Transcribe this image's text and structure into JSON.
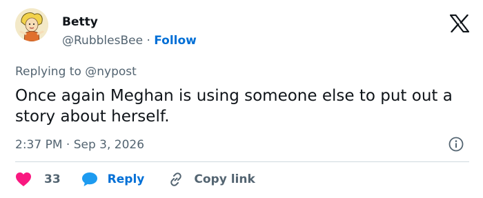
{
  "tweet": {
    "author_name": "Betty",
    "handle": "@RubblesBee",
    "separator": "·",
    "follow_label": "Follow",
    "replying_prefix": "Replying to",
    "replying_to": "@nypost",
    "text": "Once again Meghan is using someone else to put out a story about herself.",
    "time": "2:37 PM",
    "date": "Sep 3, 2026"
  },
  "actions": {
    "like_count": "33",
    "reply_label": "Reply",
    "copy_label": "Copy link"
  },
  "icons": {
    "logo": "x-logo-icon",
    "info": "info-icon",
    "like": "heart-icon",
    "reply": "speech-bubble-icon",
    "copy": "link-icon"
  },
  "colors": {
    "text": "#0f1419",
    "secondary": "#536471",
    "link": "#006fd6",
    "like": "#f91880",
    "reply": "#1d9bf0",
    "divider": "#cfd9de"
  }
}
